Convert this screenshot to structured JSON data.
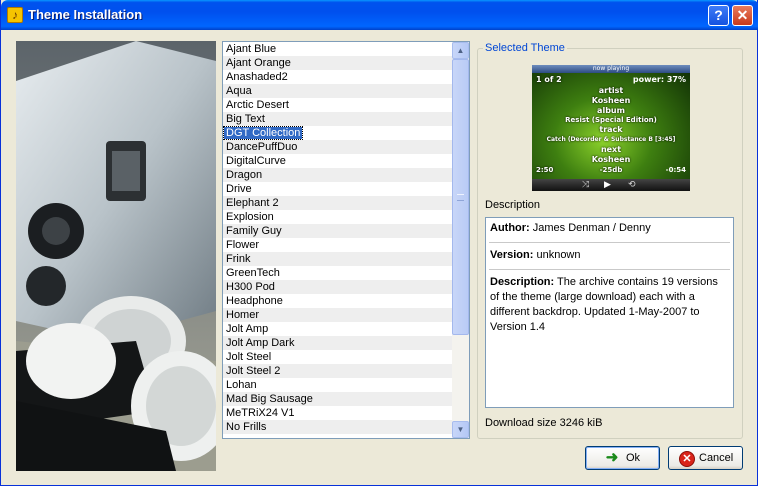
{
  "window": {
    "title": "Theme Installation",
    "app_icon_glyph": "♪",
    "help_glyph": "?",
    "close_glyph": "✕",
    "title_color": "#0054e3"
  },
  "theme_list": {
    "items": [
      "Ajant Blue",
      "Ajant Orange",
      "Anashaded2",
      "Aqua",
      "Arctic Desert",
      "Big Text",
      "DGT Collection",
      "DancePuffDuo",
      "DigitalCurve",
      "Dragon",
      "Drive",
      "Elephant 2",
      "Explosion",
      "Family Guy",
      "Flower",
      "Frink",
      "GreenTech",
      "H300 Pod",
      "Headphone",
      "Homer",
      "Jolt Amp",
      "Jolt Amp Dark",
      "Jolt Steel",
      "Jolt Steel 2",
      "Lohan",
      "Mad Big Sausage",
      "MeTRiX24 V1",
      "No Frills"
    ],
    "selected_index": 6,
    "selection_color": "#316ac5"
  },
  "selected_theme": {
    "group_label": "Selected Theme",
    "preview": {
      "header": "now playing",
      "track_count": "1 of 2",
      "power": "power: 37%",
      "artist_label": "artist",
      "artist": "Kosheen",
      "album_label": "album",
      "album": "Resist (Special Edition)",
      "track_label": "track",
      "track": "Catch (Decorder & Substance B [3:45]",
      "next_label": "next",
      "next": "Kosheen",
      "elapsed": "2:50",
      "volume": "-25db",
      "remaining": "-0:54"
    }
  },
  "description": {
    "label": "Description",
    "author_key": "Author:",
    "author_value": " James Denman / Denny",
    "version_key": "Version:",
    "version_value": " unknown",
    "desc_key": "Description:",
    "desc_value": " The archive contains 19 versions of the theme (large download) each with a different backdrop. Updated 1-May-2007 to Version 1.4"
  },
  "download_size": "Download size 3246 kiB",
  "buttons": {
    "ok_label": "Ok",
    "cancel_label": "Cancel",
    "ok_icon": "arrow-right-icon",
    "cancel_icon": "cancel-icon"
  }
}
